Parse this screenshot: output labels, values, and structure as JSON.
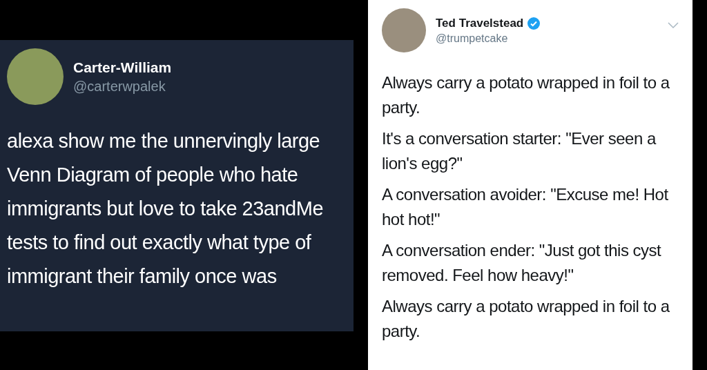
{
  "tweets": [
    {
      "name": "Carter-William",
      "handle": "@carterwpalek",
      "verified": false,
      "kind": "dark",
      "paragraphs": [
        "alexa show me the unnervingly large Venn Diagram of people who hate immigrants but love to take 23andMe tests to find out exactly what type of immigrant their family once was"
      ]
    },
    {
      "name": "Ted Travelstead",
      "handle": "@trumpetcake",
      "verified": true,
      "kind": "light",
      "paragraphs": [
        "Always carry a potato wrapped in foil to a party.",
        "It's a conversation starter: \"Ever seen a lion's egg?\"",
        "A conversation avoider: \"Excuse me! Hot hot hot!\"",
        "A conversation ender: \"Just got this cyst removed. Feel how heavy!\"",
        "Always carry a potato wrapped in foil to a party."
      ]
    }
  ]
}
